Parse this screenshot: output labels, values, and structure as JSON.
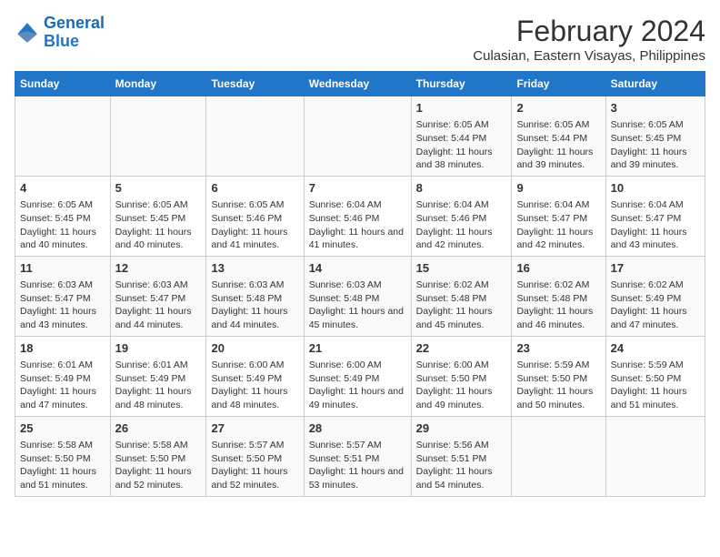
{
  "logo": {
    "line1": "General",
    "line2": "Blue"
  },
  "title": "February 2024",
  "subtitle": "Culasian, Eastern Visayas, Philippines",
  "header_days": [
    "Sunday",
    "Monday",
    "Tuesday",
    "Wednesday",
    "Thursday",
    "Friday",
    "Saturday"
  ],
  "weeks": [
    [
      {
        "day": "",
        "sunrise": "",
        "sunset": "",
        "daylight": ""
      },
      {
        "day": "",
        "sunrise": "",
        "sunset": "",
        "daylight": ""
      },
      {
        "day": "",
        "sunrise": "",
        "sunset": "",
        "daylight": ""
      },
      {
        "day": "",
        "sunrise": "",
        "sunset": "",
        "daylight": ""
      },
      {
        "day": "1",
        "sunrise": "Sunrise: 6:05 AM",
        "sunset": "Sunset: 5:44 PM",
        "daylight": "Daylight: 11 hours and 38 minutes."
      },
      {
        "day": "2",
        "sunrise": "Sunrise: 6:05 AM",
        "sunset": "Sunset: 5:44 PM",
        "daylight": "Daylight: 11 hours and 39 minutes."
      },
      {
        "day": "3",
        "sunrise": "Sunrise: 6:05 AM",
        "sunset": "Sunset: 5:45 PM",
        "daylight": "Daylight: 11 hours and 39 minutes."
      }
    ],
    [
      {
        "day": "4",
        "sunrise": "Sunrise: 6:05 AM",
        "sunset": "Sunset: 5:45 PM",
        "daylight": "Daylight: 11 hours and 40 minutes."
      },
      {
        "day": "5",
        "sunrise": "Sunrise: 6:05 AM",
        "sunset": "Sunset: 5:45 PM",
        "daylight": "Daylight: 11 hours and 40 minutes."
      },
      {
        "day": "6",
        "sunrise": "Sunrise: 6:05 AM",
        "sunset": "Sunset: 5:46 PM",
        "daylight": "Daylight: 11 hours and 41 minutes."
      },
      {
        "day": "7",
        "sunrise": "Sunrise: 6:04 AM",
        "sunset": "Sunset: 5:46 PM",
        "daylight": "Daylight: 11 hours and 41 minutes."
      },
      {
        "day": "8",
        "sunrise": "Sunrise: 6:04 AM",
        "sunset": "Sunset: 5:46 PM",
        "daylight": "Daylight: 11 hours and 42 minutes."
      },
      {
        "day": "9",
        "sunrise": "Sunrise: 6:04 AM",
        "sunset": "Sunset: 5:47 PM",
        "daylight": "Daylight: 11 hours and 42 minutes."
      },
      {
        "day": "10",
        "sunrise": "Sunrise: 6:04 AM",
        "sunset": "Sunset: 5:47 PM",
        "daylight": "Daylight: 11 hours and 43 minutes."
      }
    ],
    [
      {
        "day": "11",
        "sunrise": "Sunrise: 6:03 AM",
        "sunset": "Sunset: 5:47 PM",
        "daylight": "Daylight: 11 hours and 43 minutes."
      },
      {
        "day": "12",
        "sunrise": "Sunrise: 6:03 AM",
        "sunset": "Sunset: 5:47 PM",
        "daylight": "Daylight: 11 hours and 44 minutes."
      },
      {
        "day": "13",
        "sunrise": "Sunrise: 6:03 AM",
        "sunset": "Sunset: 5:48 PM",
        "daylight": "Daylight: 11 hours and 44 minutes."
      },
      {
        "day": "14",
        "sunrise": "Sunrise: 6:03 AM",
        "sunset": "Sunset: 5:48 PM",
        "daylight": "Daylight: 11 hours and 45 minutes."
      },
      {
        "day": "15",
        "sunrise": "Sunrise: 6:02 AM",
        "sunset": "Sunset: 5:48 PM",
        "daylight": "Daylight: 11 hours and 45 minutes."
      },
      {
        "day": "16",
        "sunrise": "Sunrise: 6:02 AM",
        "sunset": "Sunset: 5:48 PM",
        "daylight": "Daylight: 11 hours and 46 minutes."
      },
      {
        "day": "17",
        "sunrise": "Sunrise: 6:02 AM",
        "sunset": "Sunset: 5:49 PM",
        "daylight": "Daylight: 11 hours and 47 minutes."
      }
    ],
    [
      {
        "day": "18",
        "sunrise": "Sunrise: 6:01 AM",
        "sunset": "Sunset: 5:49 PM",
        "daylight": "Daylight: 11 hours and 47 minutes."
      },
      {
        "day": "19",
        "sunrise": "Sunrise: 6:01 AM",
        "sunset": "Sunset: 5:49 PM",
        "daylight": "Daylight: 11 hours and 48 minutes."
      },
      {
        "day": "20",
        "sunrise": "Sunrise: 6:00 AM",
        "sunset": "Sunset: 5:49 PM",
        "daylight": "Daylight: 11 hours and 48 minutes."
      },
      {
        "day": "21",
        "sunrise": "Sunrise: 6:00 AM",
        "sunset": "Sunset: 5:49 PM",
        "daylight": "Daylight: 11 hours and 49 minutes."
      },
      {
        "day": "22",
        "sunrise": "Sunrise: 6:00 AM",
        "sunset": "Sunset: 5:50 PM",
        "daylight": "Daylight: 11 hours and 49 minutes."
      },
      {
        "day": "23",
        "sunrise": "Sunrise: 5:59 AM",
        "sunset": "Sunset: 5:50 PM",
        "daylight": "Daylight: 11 hours and 50 minutes."
      },
      {
        "day": "24",
        "sunrise": "Sunrise: 5:59 AM",
        "sunset": "Sunset: 5:50 PM",
        "daylight": "Daylight: 11 hours and 51 minutes."
      }
    ],
    [
      {
        "day": "25",
        "sunrise": "Sunrise: 5:58 AM",
        "sunset": "Sunset: 5:50 PM",
        "daylight": "Daylight: 11 hours and 51 minutes."
      },
      {
        "day": "26",
        "sunrise": "Sunrise: 5:58 AM",
        "sunset": "Sunset: 5:50 PM",
        "daylight": "Daylight: 11 hours and 52 minutes."
      },
      {
        "day": "27",
        "sunrise": "Sunrise: 5:57 AM",
        "sunset": "Sunset: 5:50 PM",
        "daylight": "Daylight: 11 hours and 52 minutes."
      },
      {
        "day": "28",
        "sunrise": "Sunrise: 5:57 AM",
        "sunset": "Sunset: 5:51 PM",
        "daylight": "Daylight: 11 hours and 53 minutes."
      },
      {
        "day": "29",
        "sunrise": "Sunrise: 5:56 AM",
        "sunset": "Sunset: 5:51 PM",
        "daylight": "Daylight: 11 hours and 54 minutes."
      },
      {
        "day": "",
        "sunrise": "",
        "sunset": "",
        "daylight": ""
      },
      {
        "day": "",
        "sunrise": "",
        "sunset": "",
        "daylight": ""
      }
    ]
  ]
}
